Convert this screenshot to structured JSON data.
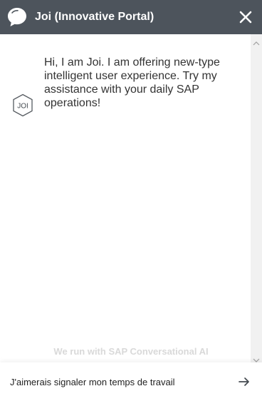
{
  "header": {
    "title": "Joi (Innovative Portal)",
    "logo_icon": "chat-bubble-icon",
    "close_icon": "close-icon",
    "background_color": "#4d545c"
  },
  "chat": {
    "avatar_label": "JOI",
    "messages": [
      {
        "sender": "bot",
        "text": "Hi, I am Joi. I am offering new-type intelligent user experience. Try my assistance with your daily SAP operations!"
      }
    ],
    "brand_footer": "We run with SAP Conversational AI"
  },
  "input": {
    "value": "J'aimerais signaler mon temps de travail",
    "send_icon": "arrow-right-icon"
  }
}
